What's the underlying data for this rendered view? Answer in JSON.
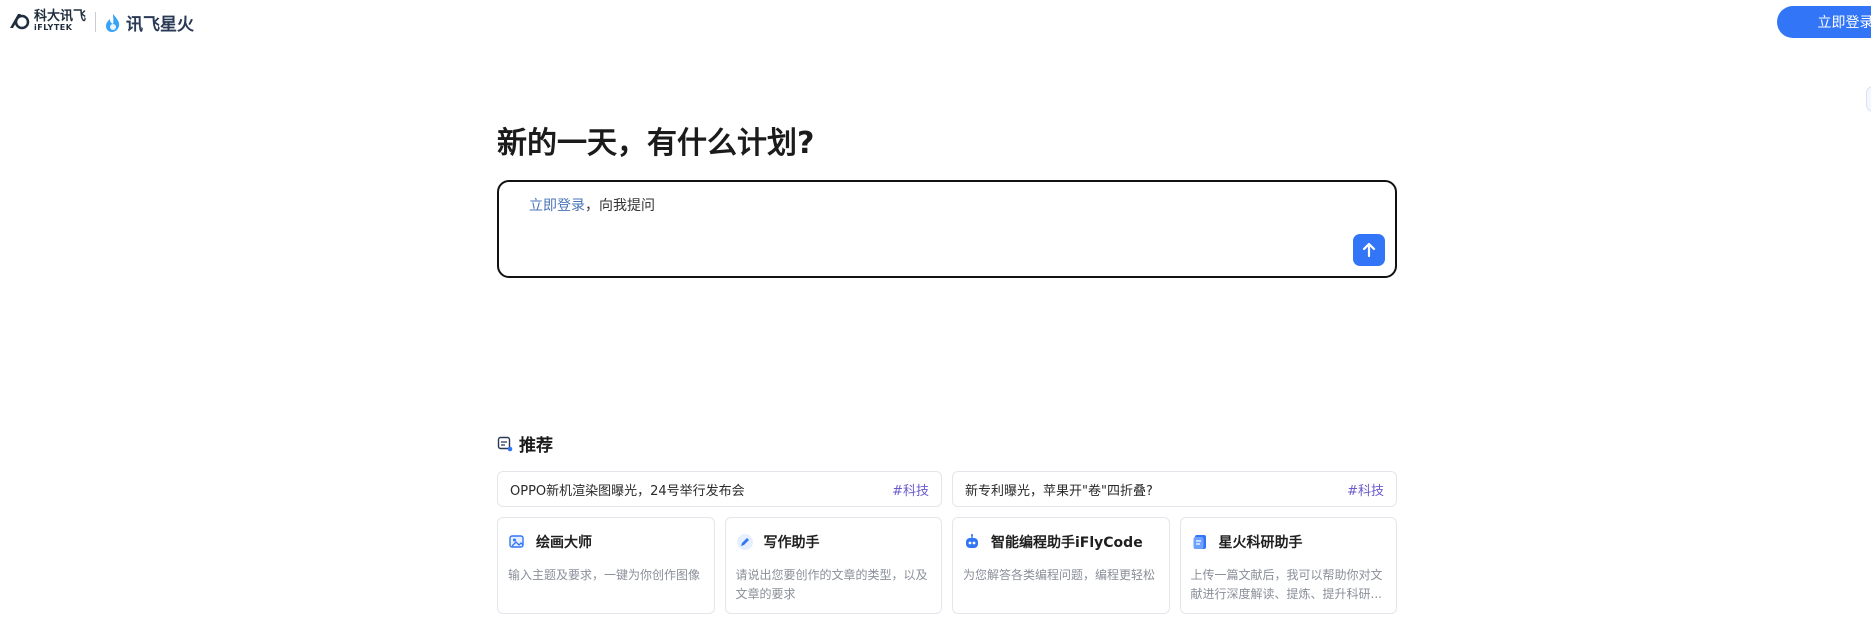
{
  "header": {
    "brand_cn": "科大讯飞",
    "brand_en": "iFLYTEK",
    "product_name": "讯飞星火",
    "login_button": "立即登录"
  },
  "main": {
    "greeting": "新的一天，有什么计划?",
    "ask_box": {
      "login_link": "立即登录",
      "prompt_suffix": "，向我提问"
    }
  },
  "recommend": {
    "title": "推荐",
    "news": [
      {
        "text": "OPPO新机渲染图曝光，24号举行发布会",
        "tag": "#科技"
      },
      {
        "text": "新专利曝光，苹果开\"卷\"四折叠?",
        "tag": "#科技"
      }
    ],
    "tools": [
      {
        "name": "绘画大师",
        "desc": "输入主题及要求，一键为你创作图像",
        "icon": "painting-icon"
      },
      {
        "name": "写作助手",
        "desc": "请说出您要创作的文章的类型，以及文章的要求",
        "icon": "pen-icon"
      },
      {
        "name": "智能编程助手iFlyCode",
        "desc": "为您解答各类编程问题，编程更轻松",
        "icon": "robot-icon"
      },
      {
        "name": "星火科研助手",
        "desc": "上传一篇文献后，我可以帮助你对文献进行深度解读、提炼、提升科研...",
        "icon": "document-icon"
      }
    ]
  },
  "colors": {
    "primary": "#3275f6",
    "tag": "#6a5acd",
    "link": "#4a74b8"
  }
}
